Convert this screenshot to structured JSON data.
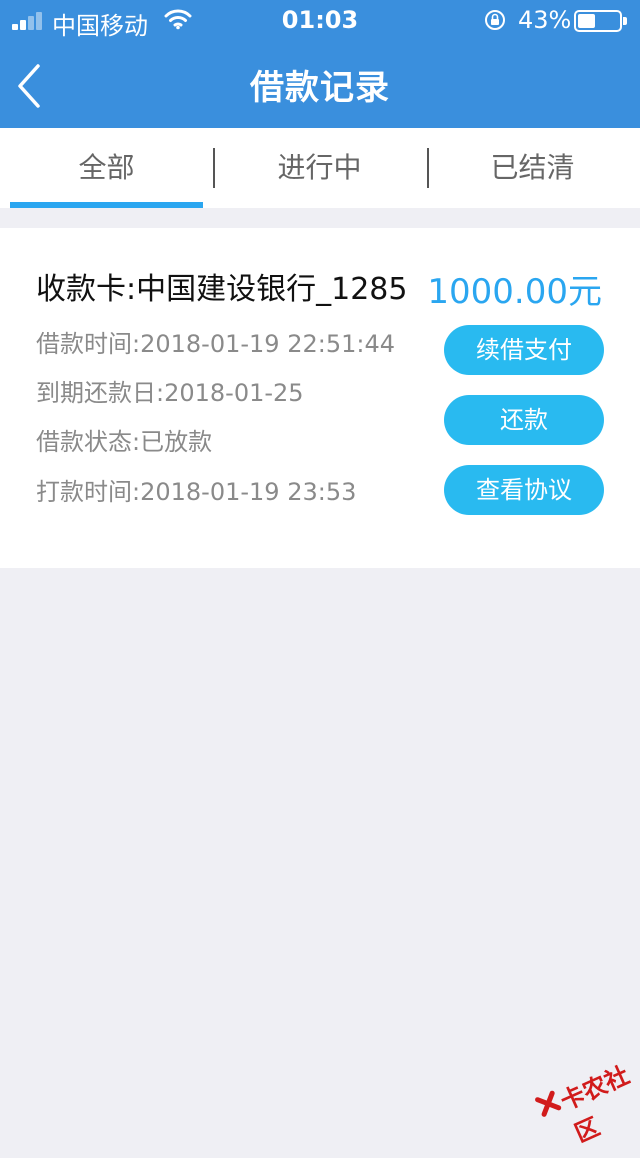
{
  "status_bar": {
    "carrier": "中国移动",
    "time": "01:03",
    "battery_percent": "43%",
    "battery_level": 0.43
  },
  "header": {
    "title": "借款记录",
    "back_icon": "chevron-left-icon"
  },
  "tabs": [
    {
      "label": "全部",
      "active": true
    },
    {
      "label": "进行中",
      "active": false
    },
    {
      "label": "已结清",
      "active": false
    }
  ],
  "loan": {
    "card_label": "收款卡:中国建设银行_1285",
    "amount": "1000.00元",
    "borrow_time": "借款时间:2018-01-19 22:51:44",
    "due_date": "到期还款日:2018-01-25",
    "status": "借款状态:已放款",
    "payment_time": "打款时间:2018-01-19 23:53",
    "buttons": {
      "renew": "续借支付",
      "repay": "还款",
      "agreement": "查看协议"
    }
  },
  "watermark": {
    "text": "卡农社区"
  },
  "colors": {
    "header_bg": "#3a8fdd",
    "accent": "#2aa6f0",
    "button_bg": "#29baf0",
    "page_bg": "#efeff4"
  }
}
